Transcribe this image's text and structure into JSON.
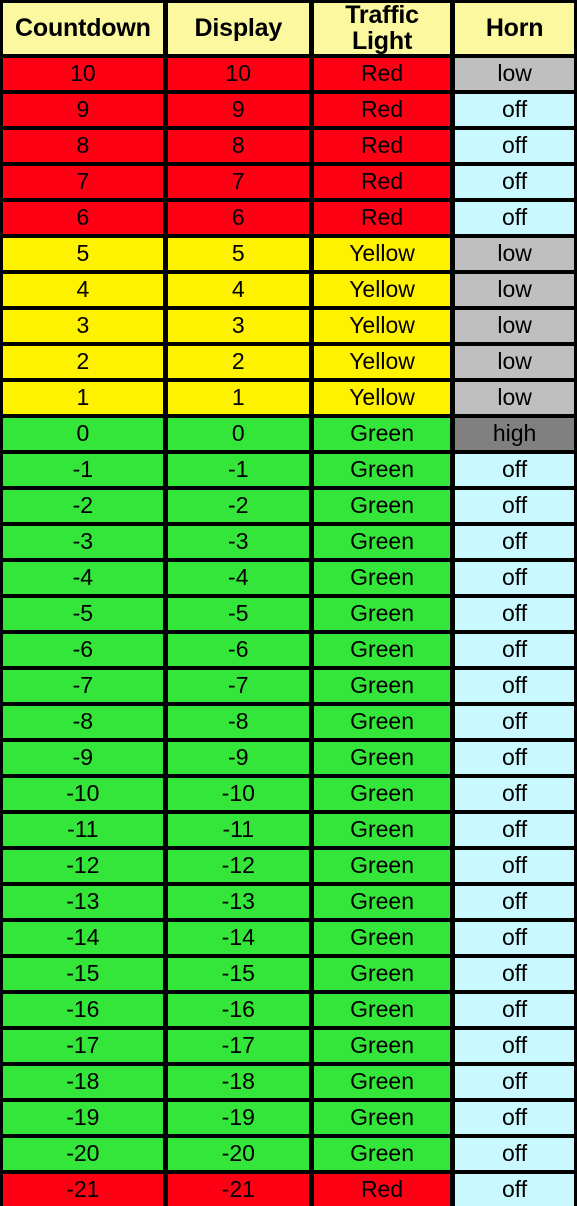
{
  "table": {
    "columns": [
      {
        "key": "countdown",
        "label": "Countdown"
      },
      {
        "key": "display",
        "label": "Display"
      },
      {
        "key": "traffic_light",
        "label": "Traffic\nLight"
      },
      {
        "key": "horn",
        "label": "Horn"
      }
    ],
    "header_bg": "#FBF8A0",
    "state_colors": {
      "Red": "#FE0014",
      "Yellow": "#FFF200",
      "Green": "#34E63A",
      "off": "#C9F9FF",
      "low": "#BFBFBF",
      "high": "#808080"
    },
    "rows": [
      {
        "countdown": "10",
        "display": "10",
        "traffic_light": "Red",
        "horn": "low"
      },
      {
        "countdown": "9",
        "display": "9",
        "traffic_light": "Red",
        "horn": "off"
      },
      {
        "countdown": "8",
        "display": "8",
        "traffic_light": "Red",
        "horn": "off"
      },
      {
        "countdown": "7",
        "display": "7",
        "traffic_light": "Red",
        "horn": "off"
      },
      {
        "countdown": "6",
        "display": "6",
        "traffic_light": "Red",
        "horn": "off"
      },
      {
        "countdown": "5",
        "display": "5",
        "traffic_light": "Yellow",
        "horn": "low"
      },
      {
        "countdown": "4",
        "display": "4",
        "traffic_light": "Yellow",
        "horn": "low"
      },
      {
        "countdown": "3",
        "display": "3",
        "traffic_light": "Yellow",
        "horn": "low"
      },
      {
        "countdown": "2",
        "display": "2",
        "traffic_light": "Yellow",
        "horn": "low"
      },
      {
        "countdown": "1",
        "display": "1",
        "traffic_light": "Yellow",
        "horn": "low"
      },
      {
        "countdown": "0",
        "display": "0",
        "traffic_light": "Green",
        "horn": "high"
      },
      {
        "countdown": "-1",
        "display": "-1",
        "traffic_light": "Green",
        "horn": "off"
      },
      {
        "countdown": "-2",
        "display": "-2",
        "traffic_light": "Green",
        "horn": "off"
      },
      {
        "countdown": "-3",
        "display": "-3",
        "traffic_light": "Green",
        "horn": "off"
      },
      {
        "countdown": "-4",
        "display": "-4",
        "traffic_light": "Green",
        "horn": "off"
      },
      {
        "countdown": "-5",
        "display": "-5",
        "traffic_light": "Green",
        "horn": "off"
      },
      {
        "countdown": "-6",
        "display": "-6",
        "traffic_light": "Green",
        "horn": "off"
      },
      {
        "countdown": "-7",
        "display": "-7",
        "traffic_light": "Green",
        "horn": "off"
      },
      {
        "countdown": "-8",
        "display": "-8",
        "traffic_light": "Green",
        "horn": "off"
      },
      {
        "countdown": "-9",
        "display": "-9",
        "traffic_light": "Green",
        "horn": "off"
      },
      {
        "countdown": "-10",
        "display": "-10",
        "traffic_light": "Green",
        "horn": "off"
      },
      {
        "countdown": "-11",
        "display": "-11",
        "traffic_light": "Green",
        "horn": "off"
      },
      {
        "countdown": "-12",
        "display": "-12",
        "traffic_light": "Green",
        "horn": "off"
      },
      {
        "countdown": "-13",
        "display": "-13",
        "traffic_light": "Green",
        "horn": "off"
      },
      {
        "countdown": "-14",
        "display": "-14",
        "traffic_light": "Green",
        "horn": "off"
      },
      {
        "countdown": "-15",
        "display": "-15",
        "traffic_light": "Green",
        "horn": "off"
      },
      {
        "countdown": "-16",
        "display": "-16",
        "traffic_light": "Green",
        "horn": "off"
      },
      {
        "countdown": "-17",
        "display": "-17",
        "traffic_light": "Green",
        "horn": "off"
      },
      {
        "countdown": "-18",
        "display": "-18",
        "traffic_light": "Green",
        "horn": "off"
      },
      {
        "countdown": "-19",
        "display": "-19",
        "traffic_light": "Green",
        "horn": "off"
      },
      {
        "countdown": "-20",
        "display": "-20",
        "traffic_light": "Green",
        "horn": "off"
      },
      {
        "countdown": "-21",
        "display": "-21",
        "traffic_light": "Red",
        "horn": "off"
      }
    ]
  }
}
